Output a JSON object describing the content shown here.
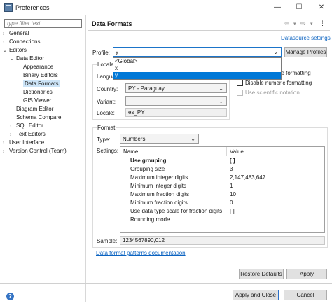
{
  "window": {
    "title": "Preferences",
    "minimize": "—",
    "maximize": "☐",
    "close": "✕"
  },
  "sidebar": {
    "filter_placeholder": "type filter text",
    "items": [
      {
        "label": "General",
        "level": 0,
        "toggle": "›"
      },
      {
        "label": "Connections",
        "level": 0,
        "toggle": "›"
      },
      {
        "label": "Editors",
        "level": 0,
        "toggle": "⌄"
      },
      {
        "label": "Data Editor",
        "level": 1,
        "toggle": "⌄"
      },
      {
        "label": "Appearance",
        "level": 2,
        "toggle": ""
      },
      {
        "label": "Binary Editors",
        "level": 2,
        "toggle": ""
      },
      {
        "label": "Data Formats",
        "level": 2,
        "toggle": "",
        "selected": true
      },
      {
        "label": "Dictionaries",
        "level": 2,
        "toggle": ""
      },
      {
        "label": "GIS Viewer",
        "level": 2,
        "toggle": ""
      },
      {
        "label": "Diagram Editor",
        "level": 1,
        "toggle": ""
      },
      {
        "label": "Schema Compare",
        "level": 1,
        "toggle": ""
      },
      {
        "label": "SQL Editor",
        "level": 1,
        "toggle": "›"
      },
      {
        "label": "Text Editors",
        "level": 1,
        "toggle": "›"
      },
      {
        "label": "User Interface",
        "level": 0,
        "toggle": "›"
      },
      {
        "label": "Version Control (Team)",
        "level": 0,
        "toggle": "›"
      }
    ]
  },
  "page": {
    "title": "Data Formats",
    "nav_back": "⇦",
    "nav_menu": "▾",
    "nav_forward": "⇨",
    "nav_more": "⋮",
    "datasource_link": "Datasource settings",
    "profile_label": "Profile:",
    "profile_value": "y",
    "manage_profiles": "Manage Profiles",
    "profile_options": [
      "<Global>",
      "x",
      "y"
    ],
    "locale_label": "Locale",
    "language_label": "Langua",
    "country_label": "Country:",
    "country_value": "PY - Paraguay",
    "variant_label": "Variant:",
    "variant_value": "",
    "locale_field_label": "Locale:",
    "locale_value": "es_PY",
    "native_label": "ne formatting",
    "disable_numeric": "Disable numeric formatting",
    "use_scientific": "Use scientific notation",
    "format_label": "Format",
    "type_label": "Type:",
    "type_value": "Numbers",
    "settings_label": "Settings:",
    "table_headers": [
      "Name",
      "Value"
    ],
    "table_rows": [
      {
        "name": "Use grouping",
        "value": "[ ]",
        "bold": true
      },
      {
        "name": "Grouping size",
        "value": "3"
      },
      {
        "name": "Maximum integer digits",
        "value": "2,147,483,647"
      },
      {
        "name": "Minimum integer digits",
        "value": "1"
      },
      {
        "name": "Maximum fraction digits",
        "value": "10"
      },
      {
        "name": "Minimum fraction digits",
        "value": "0"
      },
      {
        "name": "Use data type scale for fraction digits",
        "value": "[ ]"
      },
      {
        "name": "Rounding mode",
        "value": ""
      }
    ],
    "sample_label": "Sample:",
    "sample_value": "1234567890,012",
    "patterns_link": "Data format patterns documentation",
    "restore_defaults": "Restore Defaults",
    "apply": "Apply"
  },
  "footer": {
    "help_icon": "?",
    "apply_close": "Apply and Close",
    "cancel": "Cancel"
  },
  "colors": {
    "accent": "#0078d7",
    "link": "#0b63c1",
    "selection": "#cce4f7"
  }
}
